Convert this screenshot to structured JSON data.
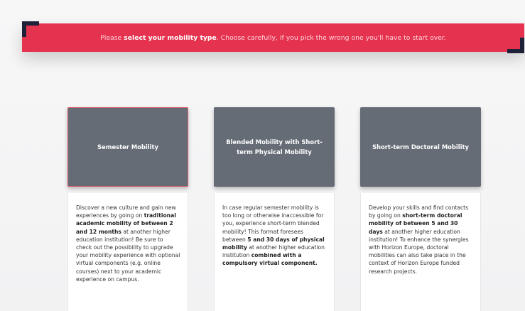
{
  "banner": {
    "prefix": "Please ",
    "emphasis": "select your mobility type",
    "suffix": ". Choose carefully, if you pick the wrong one you'll have to start over."
  },
  "options": [
    {
      "title": "Semester Mobility",
      "selected": true,
      "description": [
        {
          "t": "Discover a new culture and gain new experiences by going on ",
          "b": false
        },
        {
          "t": "traditional academic mobility of between 2 and 12 months",
          "b": true
        },
        {
          "t": " at another higher education institution! Be sure to check out the possibility to upgrade your mobility experience with optional virtual components (e.g. online courses) next to your academic experience on campus.",
          "b": false
        }
      ]
    },
    {
      "title": "Blended Mobility with Short-term Physical Mobility",
      "selected": false,
      "description": [
        {
          "t": "In case regular semester mobility is too long or otherwise inaccessible for you, experience short-term blended mobility! This format foresees between ",
          "b": false
        },
        {
          "t": "5 and 30 days of physical mobility",
          "b": true
        },
        {
          "t": " at another higher education institution ",
          "b": false
        },
        {
          "t": "combined with a compulsory virtual component.",
          "b": true
        }
      ]
    },
    {
      "title": "Short-term Doctoral Mobility",
      "selected": false,
      "description": [
        {
          "t": "Develop your skills and find contacts by going on ",
          "b": false
        },
        {
          "t": "short-term doctoral mobility of between 5 and 30 days",
          "b": true
        },
        {
          "t": " at another higher education institution! To enhance the synergies with Horizon Europe, doctoral mobilities can also take place in the context of Horizon Europe funded research projects.",
          "b": false
        }
      ]
    }
  ],
  "colors": {
    "banner": "#e5324f",
    "bracket": "#1e2238",
    "card": "#656c76",
    "selected_border": "#d75a6a"
  }
}
